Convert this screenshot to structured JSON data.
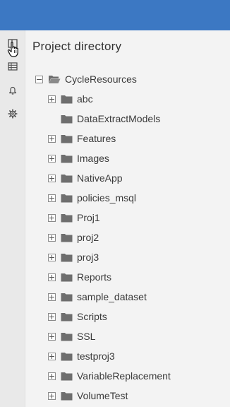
{
  "panel": {
    "title": "Project directory"
  },
  "tree": {
    "root": {
      "label": "CycleResources",
      "expanded": true
    },
    "children": [
      {
        "label": "abc",
        "expandable": true
      },
      {
        "label": "DataExtractModels",
        "expandable": false
      },
      {
        "label": "Features",
        "expandable": true
      },
      {
        "label": "Images",
        "expandable": true
      },
      {
        "label": "NativeApp",
        "expandable": true
      },
      {
        "label": "policies_msql",
        "expandable": true
      },
      {
        "label": "Proj1",
        "expandable": true
      },
      {
        "label": "proj2",
        "expandable": true
      },
      {
        "label": "proj3",
        "expandable": true
      },
      {
        "label": "Reports",
        "expandable": true
      },
      {
        "label": "sample_dataset",
        "expandable": true
      },
      {
        "label": "Scripts",
        "expandable": true
      },
      {
        "label": "SSL",
        "expandable": true
      },
      {
        "label": "testproj3",
        "expandable": true
      },
      {
        "label": "VariableReplacement",
        "expandable": true
      },
      {
        "label": "VolumeTest",
        "expandable": true
      }
    ]
  },
  "rail": {
    "items": [
      {
        "icon": "explorer-icon",
        "active": true
      },
      {
        "icon": "table-icon"
      },
      {
        "icon": "bell-icon"
      },
      {
        "icon": "gear-icon"
      }
    ]
  },
  "colors": {
    "header": "#3c78c3",
    "folder": "#6e6e6e",
    "background": "#f3f3f3",
    "rail": "#e9e9e9"
  }
}
